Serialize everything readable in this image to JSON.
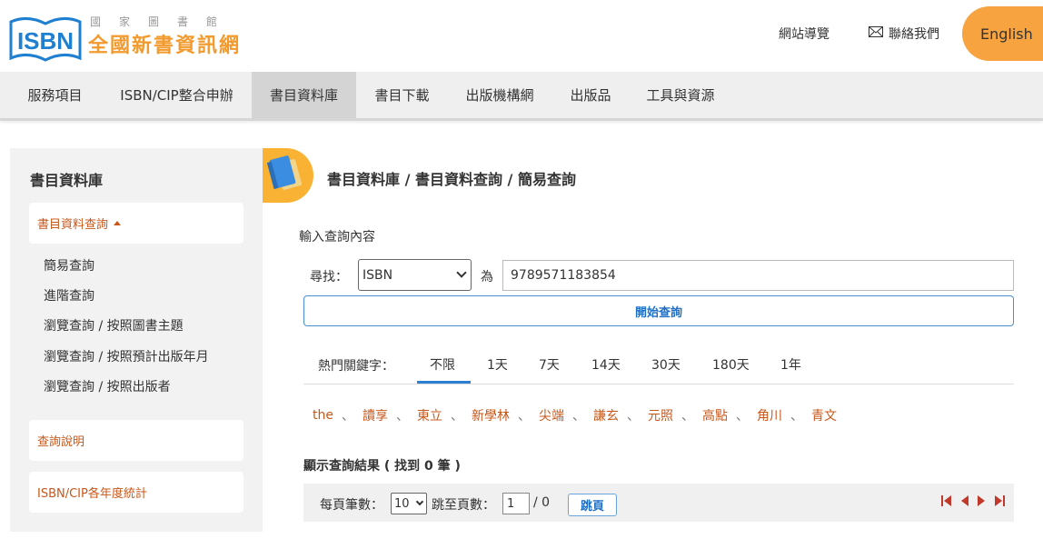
{
  "header": {
    "logo_text": "ISBN",
    "site_subtitle": "國家圖書館",
    "site_title": "全國新書資訊網",
    "links": [
      {
        "label": "網站導覽"
      },
      {
        "label": "聯絡我們",
        "icon": "envelope-icon"
      }
    ],
    "language_button": "English"
  },
  "nav": {
    "items": [
      {
        "label": "服務項目"
      },
      {
        "label": "ISBN/CIP整合申辦"
      },
      {
        "label": "書目資料庫",
        "active": true
      },
      {
        "label": "書目下載"
      },
      {
        "label": "出版機構網"
      },
      {
        "label": "出版品"
      },
      {
        "label": "工具與資源"
      }
    ]
  },
  "sidebar": {
    "title": "書目資料庫",
    "group_label": "書目資料查詢",
    "sub_items": [
      "簡易查詢",
      "進階查詢",
      "瀏覽查詢 / 按照圖書主題",
      "瀏覽查詢 / 按照預計出版年月",
      "瀏覽查詢 / 按照出版者"
    ],
    "cards": [
      "查詢說明",
      "ISBN/CIP各年度統計"
    ]
  },
  "main": {
    "breadcrumb": "書目資料庫 / 書目資料查詢 / 簡易查詢",
    "section_label": "輸入查詢內容",
    "find_label": "尋找：",
    "field_select": "ISBN",
    "is_label": "為",
    "query_value": "9789571183854",
    "search_button": "開始查詢",
    "hot_keywords_label": "熱門關鍵字：",
    "tabs": [
      "不限",
      "1天",
      "7天",
      "14天",
      "30天",
      "180天",
      "1年"
    ],
    "keywords": [
      "the",
      "讀享",
      "東立",
      "新學林",
      "尖端",
      "謙玄",
      "元照",
      "高點",
      "角川",
      "青文"
    ],
    "keyword_separator": "、",
    "result_title": "顯示查詢結果 ( 找到 0 筆 )",
    "pager": {
      "per_page_label": "每頁筆數：",
      "per_page_value": "10",
      "jump_label": "跳至頁數：",
      "page_value": "1",
      "page_total": "/ 0",
      "jump_button": "跳頁"
    }
  },
  "colors": {
    "accent_orange": "#f7a440",
    "link_brown": "#c8571a",
    "primary_blue": "#1f6fc4",
    "nav_active": "#d4d4d4"
  }
}
